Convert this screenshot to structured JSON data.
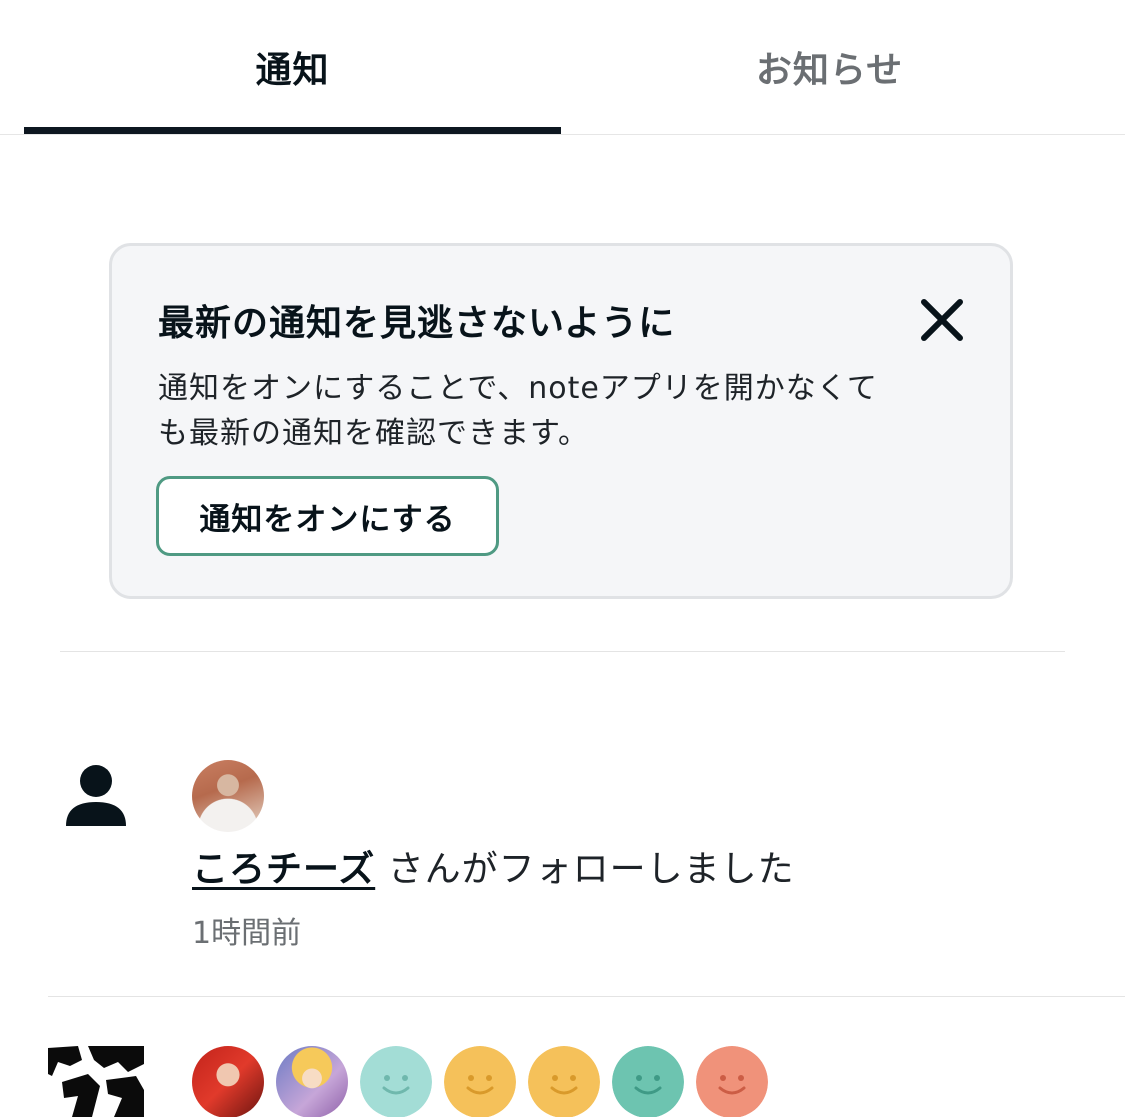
{
  "tabs": [
    {
      "label": "通知",
      "active": true
    },
    {
      "label": "お知らせ",
      "active": false
    }
  ],
  "banner": {
    "title": "最新の通知を見逃さないように",
    "body": "通知をオンにすることで、noteアプリを開かなくても最新の通知を確認できます。",
    "button_label": "通知をオンにする",
    "close_icon": "close-icon"
  },
  "notifications": [
    {
      "icon": "person-icon",
      "user": "ころチーズ",
      "action_text": " さんがフォローしました",
      "time": "1時間前"
    },
    {
      "avatars": [
        {
          "kind": "photo"
        },
        {
          "kind": "photo"
        },
        {
          "kind": "smile",
          "color": "#a3ddd6"
        },
        {
          "kind": "smile",
          "color": "#f5c15a"
        },
        {
          "kind": "smile",
          "color": "#f5c15a"
        },
        {
          "kind": "smile",
          "color": "#6dc4b0"
        },
        {
          "kind": "smile",
          "color": "#f0927a"
        }
      ]
    }
  ],
  "colors": {
    "accent": "#4f9a83",
    "tab_indicator": "#0d1720",
    "card_bg": "#f5f6f8"
  }
}
